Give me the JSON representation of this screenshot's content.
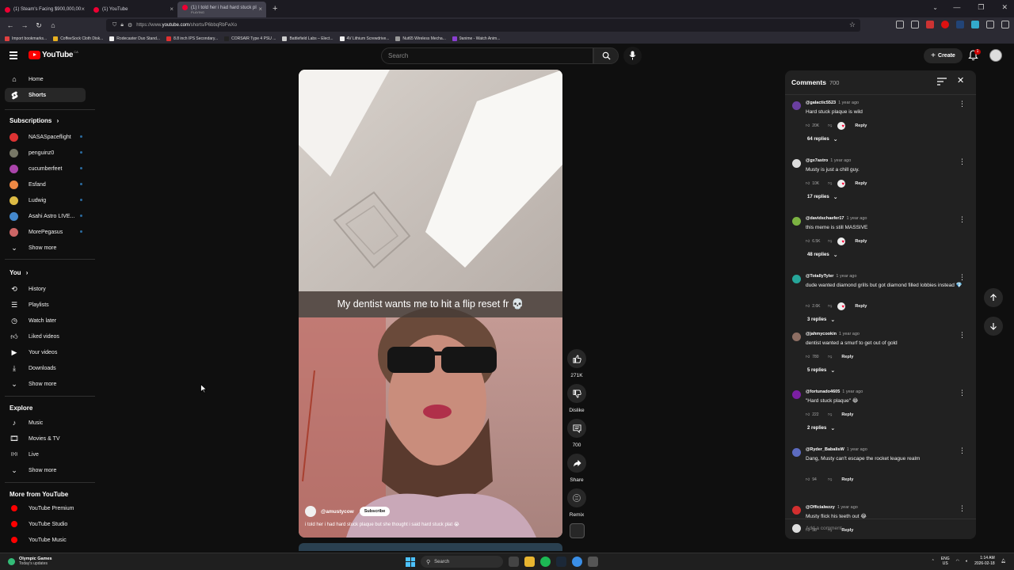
{
  "browser": {
    "tabs": [
      {
        "title": "(1) Steam's Facing $900,000,00"
      },
      {
        "title": "(1) YouTube"
      },
      {
        "title": "(1) I told her i had hard stuck pl",
        "subtitle": "PLAYING"
      }
    ],
    "url_prefix": "https://www.",
    "url_host": "youtube.com",
    "url_path": "/shorts/P6bbqRbFwXo",
    "bookmarks": [
      {
        "label": "Import bookmarks...",
        "color": "#e04040"
      },
      {
        "label": "CoffeeSock Cloth Disk...",
        "color": "#e8b020"
      },
      {
        "label": "Rodecaster Duo Stand...",
        "color": "#f0f0f0"
      },
      {
        "label": "8.8 inch IPS Secondary...",
        "color": "#e03030"
      },
      {
        "label": "CORSAIR Type 4 PSU ...",
        "color": "#222222"
      },
      {
        "label": "Battlefield Labs – Elect...",
        "color": "#cccccc"
      },
      {
        "label": "4V Lithium Screwdrive...",
        "color": "#f0f0f0"
      },
      {
        "label": "Nut65 Wireless Mecha...",
        "color": "#999999"
      },
      {
        "label": "9anime - Watch Anim...",
        "color": "#8a3fd1"
      }
    ]
  },
  "header": {
    "logo": "YouTube",
    "region": "CA",
    "search_placeholder": "Search",
    "create_label": "Create",
    "notifications": "1"
  },
  "sidebar": {
    "home": "Home",
    "shorts": "Shorts",
    "subscriptions_title": "Subscriptions",
    "subscriptions": [
      {
        "label": "NASASpaceflight",
        "color": "#d33"
      },
      {
        "label": "penguinz0",
        "color": "#776"
      },
      {
        "label": "cucumberfeet",
        "color": "#a4a"
      },
      {
        "label": "Esfand",
        "color": "#e84"
      },
      {
        "label": "Ludwig",
        "color": "#db4"
      },
      {
        "label": "Asahi Astro LIVE...",
        "color": "#48c"
      },
      {
        "label": "MorePegasus",
        "color": "#c66"
      }
    ],
    "show_more": "Show more",
    "you_title": "You",
    "you_items": [
      {
        "label": "History",
        "icon": "history-icon"
      },
      {
        "label": "Playlists",
        "icon": "playlists-icon"
      },
      {
        "label": "Watch later",
        "icon": "watch-later-icon"
      },
      {
        "label": "Liked videos",
        "icon": "liked-videos-icon"
      },
      {
        "label": "Your videos",
        "icon": "your-videos-icon"
      },
      {
        "label": "Downloads",
        "icon": "downloads-icon"
      }
    ],
    "explore_title": "Explore",
    "explore_items": [
      {
        "label": "Music",
        "icon": "music-icon"
      },
      {
        "label": "Movies & TV",
        "icon": "movies-icon"
      },
      {
        "label": "Live",
        "icon": "live-icon"
      }
    ],
    "more_title": "More from YouTube",
    "more_items": [
      {
        "label": "YouTube Premium"
      },
      {
        "label": "YouTube Studio"
      },
      {
        "label": "YouTube Music"
      }
    ]
  },
  "video": {
    "caption": "My dentist wants me to hit a flip reset fr 💀",
    "channel": "@amustycow",
    "subscribe": "Subscribe",
    "title": "i told her i had hard stuck plaque but she thought i said hard stuck plat 😭"
  },
  "actions": {
    "likes": "271K",
    "dislike": "Dislike",
    "comments": "700",
    "share": "Share",
    "remix": "Remix"
  },
  "comments": {
    "title": "Comments",
    "count": "700",
    "add_placeholder": "Add a comment...",
    "reply_label": "Reply",
    "items": [
      {
        "user": "@galactic5523",
        "time": "1 year ago",
        "text": "Hard stuck plaque is wild",
        "likes": "20K",
        "replies": "64 replies",
        "color": "#6a3fa0"
      },
      {
        "user": "@gx7astro",
        "time": "1 year ago",
        "text": "Musty is just a chill guy.",
        "likes": "10K",
        "replies": "17 replies",
        "color": "#dddddd"
      },
      {
        "user": "@davidschaefer17",
        "time": "1 year ago",
        "text": "this meme is still MASSIVE",
        "likes": "6.5K",
        "replies": "48 replies",
        "color": "#7cb342"
      },
      {
        "user": "@TotallyTyler",
        "time": "1 year ago",
        "text": "dude wanted diamond grills but got diamond filled lobbies instead 💎",
        "likes": "2.6K",
        "replies": "3 replies",
        "color": "#26a69a"
      },
      {
        "user": "@jahmycookin",
        "time": "1 year ago",
        "text": "dentist wanted a smurf to get out of gold",
        "likes": "780",
        "replies": "5 replies",
        "color": "#8d6e63"
      },
      {
        "user": "@fortunado4605",
        "time": "1 year ago",
        "text": "\"Hard stuck plaque\" 😂",
        "likes": "222",
        "replies": "2 replies",
        "color": "#7b1fa2"
      },
      {
        "user": "@Ryder_BabalisW",
        "time": "1 year ago",
        "text": "Dang, Musty can't escape the rocket league realm",
        "likes": "94",
        "replies": "",
        "color": "#5c6bc0"
      },
      {
        "user": "@Officialwzzy",
        "time": "1 year ago",
        "text": "Musty flick his teeth out 😂",
        "likes": "58",
        "replies": "",
        "color": "#d32f2f"
      }
    ]
  },
  "taskbar": {
    "weather_title": "Olympic Games",
    "weather_sub": "Today's updates",
    "search": "Search",
    "lang1": "ENG",
    "lang2": "US",
    "time": "1:14 AM",
    "date": "2026-02-18"
  }
}
